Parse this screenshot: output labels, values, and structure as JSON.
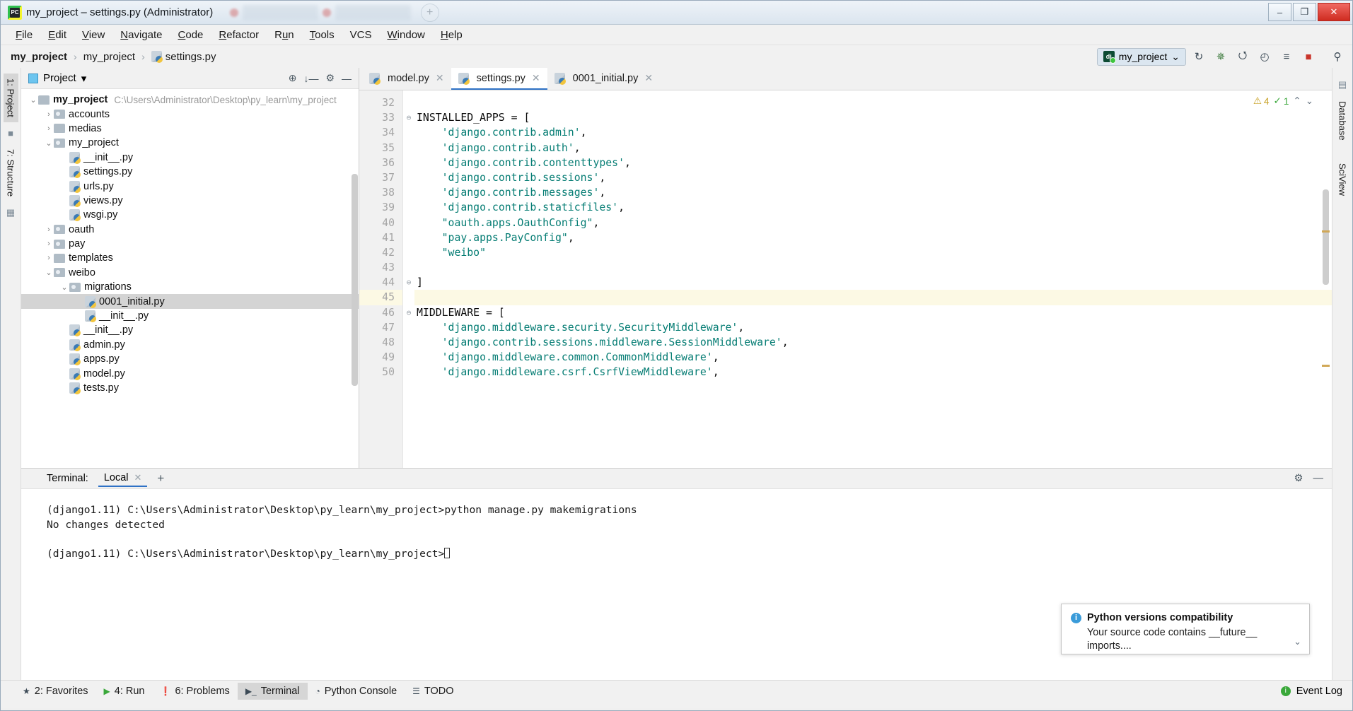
{
  "window": {
    "title": "my_project – settings.py (Administrator)",
    "app_icon": "pycharm-icon",
    "minimize_label": "–",
    "maximize_label": "❐",
    "close_label": "✕"
  },
  "menu": {
    "items": [
      {
        "label": "File",
        "mnemonic": "F"
      },
      {
        "label": "Edit",
        "mnemonic": "E"
      },
      {
        "label": "View",
        "mnemonic": "V"
      },
      {
        "label": "Navigate",
        "mnemonic": "N"
      },
      {
        "label": "Code",
        "mnemonic": "C"
      },
      {
        "label": "Refactor",
        "mnemonic": "R"
      },
      {
        "label": "Run",
        "mnemonic": "u"
      },
      {
        "label": "Tools",
        "mnemonic": "T"
      },
      {
        "label": "VCS",
        "mnemonic": ""
      },
      {
        "label": "Window",
        "mnemonic": "W"
      },
      {
        "label": "Help",
        "mnemonic": "H"
      }
    ]
  },
  "breadcrumb": {
    "items": [
      "my_project",
      "my_project",
      "settings.py"
    ],
    "separator": "›"
  },
  "toolbar": {
    "run_config": "my_project",
    "run_config_icon": "django-icon",
    "chevron": "⌄",
    "buttons": [
      {
        "name": "rerun-icon",
        "glyph": "↻"
      },
      {
        "name": "debug-icon",
        "glyph": "✹"
      },
      {
        "name": "coverage-icon",
        "glyph": "⭯"
      },
      {
        "name": "profile-icon",
        "glyph": "◴"
      },
      {
        "name": "attach-icon",
        "glyph": "≡"
      },
      {
        "name": "stop-icon",
        "glyph": "■"
      },
      {
        "name": "search-icon",
        "glyph": "⚲"
      }
    ]
  },
  "left_rail": {
    "tabs": [
      {
        "label": "1: Project",
        "active": true
      },
      {
        "label": "7: Structure",
        "active": false
      }
    ]
  },
  "right_rail": {
    "tabs": [
      {
        "label": "Database"
      },
      {
        "label": "SciView"
      }
    ]
  },
  "project_panel": {
    "title": "Project",
    "dropdown_glyph": "▾",
    "actions": [
      {
        "name": "locate-icon",
        "glyph": "⊕"
      },
      {
        "name": "collapse-all-icon",
        "glyph": "⤓"
      },
      {
        "name": "settings-gear-icon",
        "glyph": "⚙"
      },
      {
        "name": "hide-icon",
        "glyph": "—"
      }
    ],
    "tree": [
      {
        "depth": 0,
        "arrow": "⌄",
        "icon": "folder",
        "label": "my_project",
        "bold": true,
        "path": "C:\\Users\\Administrator\\Desktop\\py_learn\\my_project",
        "selected": false
      },
      {
        "depth": 1,
        "arrow": "›",
        "icon": "folder-src",
        "label": "accounts",
        "bold": false,
        "path": "",
        "selected": false
      },
      {
        "depth": 1,
        "arrow": "›",
        "icon": "folder",
        "label": "medias",
        "bold": false,
        "path": "",
        "selected": false
      },
      {
        "depth": 1,
        "arrow": "⌄",
        "icon": "folder-src",
        "label": "my_project",
        "bold": false,
        "path": "",
        "selected": false
      },
      {
        "depth": 2,
        "arrow": "",
        "icon": "python-file",
        "label": "__init__.py",
        "bold": false,
        "path": "",
        "selected": false
      },
      {
        "depth": 2,
        "arrow": "",
        "icon": "python-file",
        "label": "settings.py",
        "bold": false,
        "path": "",
        "selected": false
      },
      {
        "depth": 2,
        "arrow": "",
        "icon": "python-file",
        "label": "urls.py",
        "bold": false,
        "path": "",
        "selected": false
      },
      {
        "depth": 2,
        "arrow": "",
        "icon": "python-file",
        "label": "views.py",
        "bold": false,
        "path": "",
        "selected": false
      },
      {
        "depth": 2,
        "arrow": "",
        "icon": "python-file",
        "label": "wsgi.py",
        "bold": false,
        "path": "",
        "selected": false
      },
      {
        "depth": 1,
        "arrow": "›",
        "icon": "folder-src",
        "label": "oauth",
        "bold": false,
        "path": "",
        "selected": false
      },
      {
        "depth": 1,
        "arrow": "›",
        "icon": "folder-src",
        "label": "pay",
        "bold": false,
        "path": "",
        "selected": false
      },
      {
        "depth": 1,
        "arrow": "›",
        "icon": "folder",
        "label": "templates",
        "bold": false,
        "path": "",
        "selected": false
      },
      {
        "depth": 1,
        "arrow": "⌄",
        "icon": "folder-src",
        "label": "weibo",
        "bold": false,
        "path": "",
        "selected": false
      },
      {
        "depth": 2,
        "arrow": "⌄",
        "icon": "folder-src",
        "label": "migrations",
        "bold": false,
        "path": "",
        "selected": false
      },
      {
        "depth": 3,
        "arrow": "",
        "icon": "python-file",
        "label": "0001_initial.py",
        "bold": false,
        "path": "",
        "selected": true
      },
      {
        "depth": 3,
        "arrow": "",
        "icon": "python-file",
        "label": "__init__.py",
        "bold": false,
        "path": "",
        "selected": false
      },
      {
        "depth": 2,
        "arrow": "",
        "icon": "python-file",
        "label": "__init__.py",
        "bold": false,
        "path": "",
        "selected": false
      },
      {
        "depth": 2,
        "arrow": "",
        "icon": "python-file",
        "label": "admin.py",
        "bold": false,
        "path": "",
        "selected": false
      },
      {
        "depth": 2,
        "arrow": "",
        "icon": "python-file",
        "label": "apps.py",
        "bold": false,
        "path": "",
        "selected": false
      },
      {
        "depth": 2,
        "arrow": "",
        "icon": "python-file",
        "label": "model.py",
        "bold": false,
        "path": "",
        "selected": false
      },
      {
        "depth": 2,
        "arrow": "",
        "icon": "python-file",
        "label": "tests.py",
        "bold": false,
        "path": "",
        "selected": false
      }
    ]
  },
  "editor": {
    "tabs": [
      {
        "label": "model.py",
        "active": false,
        "close": "✕"
      },
      {
        "label": "settings.py",
        "active": true,
        "close": "✕"
      },
      {
        "label": "0001_initial.py",
        "active": false,
        "close": "✕"
      }
    ],
    "inspection": {
      "warning_icon": "⚠",
      "warning_count": "4",
      "ok_icon": "✓",
      "ok_count": "1",
      "up_glyph": "⌃",
      "down_glyph": "⌄"
    },
    "first_line_number": 32,
    "current_line": 45,
    "lines": [
      {
        "n": 32,
        "fold": "",
        "code": "",
        "type": "plain"
      },
      {
        "n": 33,
        "fold": "⊖",
        "code": "INSTALLED_APPS = [",
        "type": "plain"
      },
      {
        "n": 34,
        "fold": "",
        "code": "    'django.contrib.admin',",
        "type": "string-indent"
      },
      {
        "n": 35,
        "fold": "",
        "code": "    'django.contrib.auth',",
        "type": "string-indent"
      },
      {
        "n": 36,
        "fold": "",
        "code": "    'django.contrib.contenttypes',",
        "type": "string-indent"
      },
      {
        "n": 37,
        "fold": "",
        "code": "    'django.contrib.sessions',",
        "type": "string-indent"
      },
      {
        "n": 38,
        "fold": "",
        "code": "    'django.contrib.messages',",
        "type": "string-indent"
      },
      {
        "n": 39,
        "fold": "",
        "code": "    'django.contrib.staticfiles',",
        "type": "string-indent"
      },
      {
        "n": 40,
        "fold": "",
        "code": "    \"oauth.apps.OauthConfig\",",
        "type": "string-indent"
      },
      {
        "n": 41,
        "fold": "",
        "code": "    \"pay.apps.PayConfig\",",
        "type": "string-indent"
      },
      {
        "n": 42,
        "fold": "",
        "code": "    \"weibo\"",
        "type": "string-indent"
      },
      {
        "n": 43,
        "fold": "",
        "code": "",
        "type": "plain"
      },
      {
        "n": 44,
        "fold": "⊖",
        "code": "]",
        "type": "plain"
      },
      {
        "n": 45,
        "fold": "",
        "code": "",
        "type": "current"
      },
      {
        "n": 46,
        "fold": "⊖",
        "code": "MIDDLEWARE = [",
        "type": "plain"
      },
      {
        "n": 47,
        "fold": "",
        "code": "    'django.middleware.security.SecurityMiddleware',",
        "type": "string-indent"
      },
      {
        "n": 48,
        "fold": "",
        "code": "    'django.contrib.sessions.middleware.SessionMiddleware',",
        "type": "string-indent"
      },
      {
        "n": 49,
        "fold": "",
        "code": "    'django.middleware.common.CommonMiddleware',",
        "type": "string-indent"
      },
      {
        "n": 50,
        "fold": "",
        "code": "    'django.middleware.csrf.CsrfViewMiddleware',",
        "type": "string-indent"
      }
    ]
  },
  "terminal": {
    "label": "Terminal:",
    "tab_label": "Local",
    "tab_close": "✕",
    "add_glyph": "+",
    "settings_glyph": "⚙",
    "hide_glyph": "—",
    "lines": [
      "(django1.11) C:\\Users\\Administrator\\Desktop\\py_learn\\my_project>python manage.py makemigrations",
      "No changes detected",
      "",
      "(django1.11) C:\\Users\\Administrator\\Desktop\\py_learn\\my_project>"
    ]
  },
  "notification": {
    "icon": "info-icon",
    "title": "Python versions compatibility",
    "body": "Your source code contains __future__ imports....",
    "expand_glyph": "⌄"
  },
  "statusbar": {
    "items": [
      {
        "label": "2: Favorites",
        "icon": "star-icon",
        "glyph": "★",
        "active": false
      },
      {
        "label": "4: Run",
        "icon": "run-icon",
        "glyph": "▶",
        "active": false
      },
      {
        "label": "6: Problems",
        "icon": "problems-icon",
        "glyph": "❗",
        "active": false
      },
      {
        "label": "Terminal",
        "icon": "terminal-icon",
        "glyph": "▶_",
        "active": true
      },
      {
        "label": "Python Console",
        "icon": "python-icon",
        "glyph": "◔",
        "active": false
      },
      {
        "label": "TODO",
        "icon": "todo-icon",
        "glyph": "☰",
        "active": false
      }
    ],
    "event_log": {
      "label": "Event Log",
      "icon": "event-log-icon",
      "glyph": "i"
    }
  },
  "colors": {
    "accent": "#2f72c6",
    "string": "#067d74",
    "current_line": "#fcf9e4",
    "selection": "#d4d4d4",
    "warning": "#c9a227",
    "ok": "#3aa83a"
  }
}
